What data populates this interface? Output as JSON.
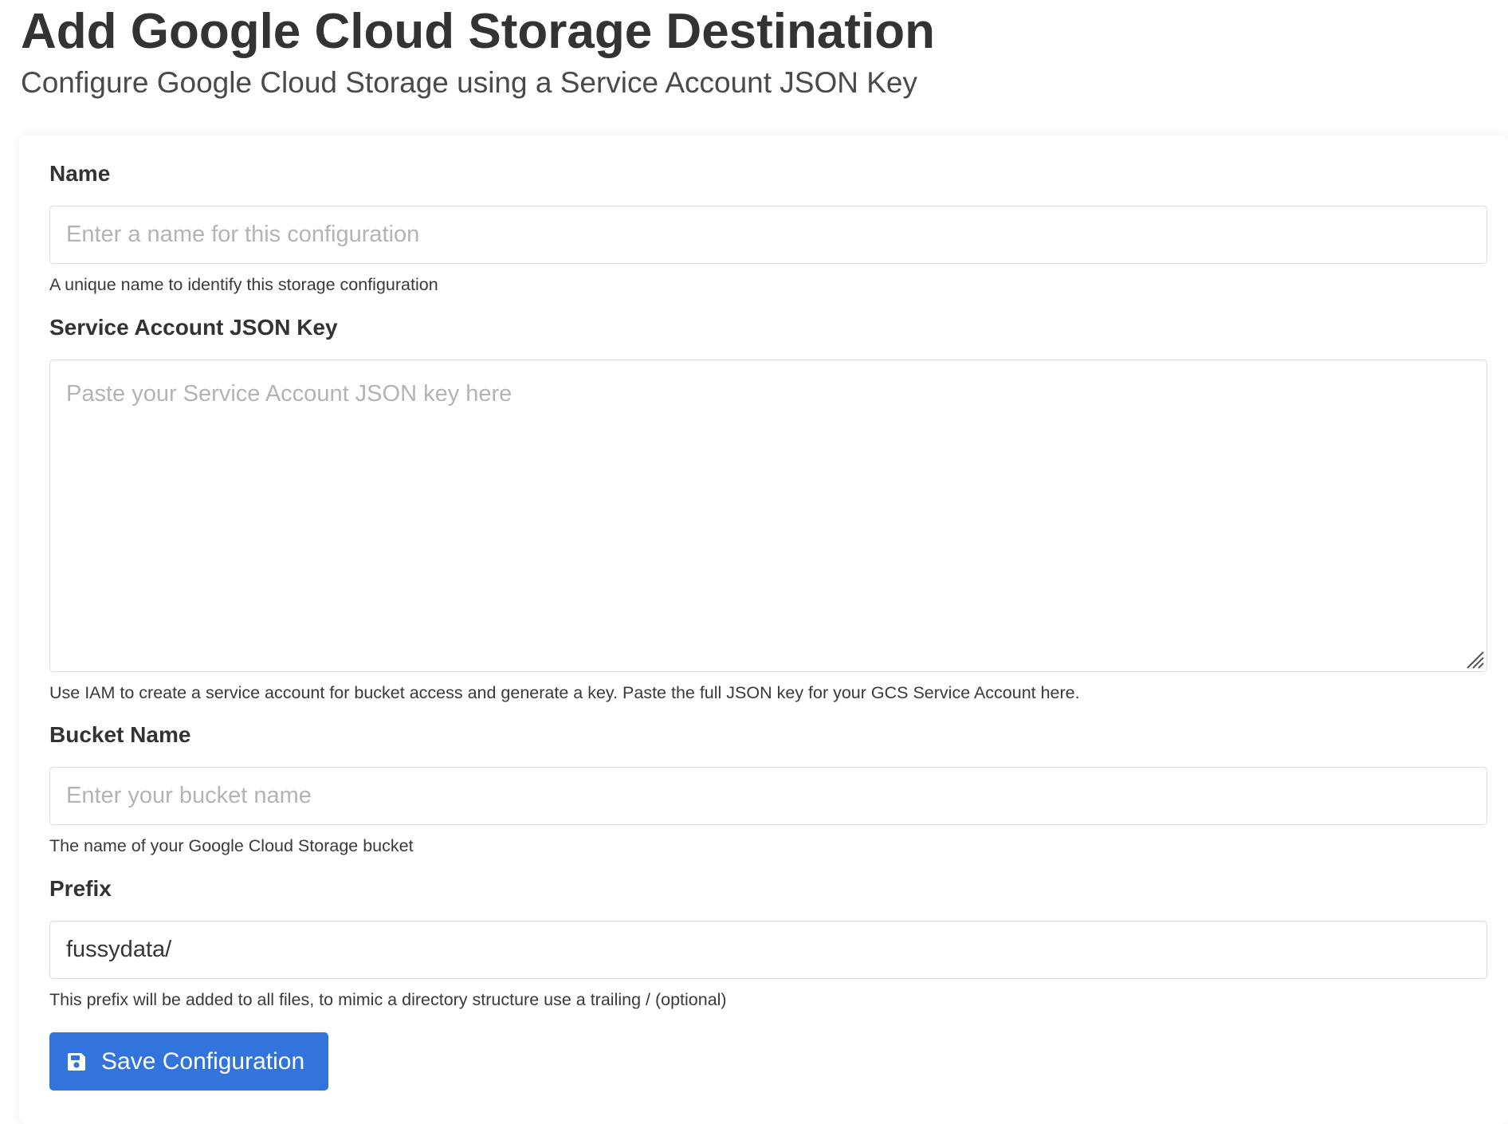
{
  "header": {
    "title": "Add Google Cloud Storage Destination",
    "subtitle": "Configure Google Cloud Storage using a Service Account JSON Key"
  },
  "form": {
    "name": {
      "label": "Name",
      "placeholder": "Enter a name for this configuration",
      "value": "",
      "help": "A unique name to identify this storage configuration"
    },
    "service_account_key": {
      "label": "Service Account JSON Key",
      "placeholder": "Paste your Service Account JSON key here",
      "value": "",
      "help": "Use IAM to create a service account for bucket access and generate a key. Paste the full JSON key for your GCS Service Account here."
    },
    "bucket_name": {
      "label": "Bucket Name",
      "placeholder": "Enter your bucket name",
      "value": "",
      "help": "The name of your Google Cloud Storage bucket"
    },
    "prefix": {
      "label": "Prefix",
      "placeholder": "",
      "value": "fussydata/",
      "help": "This prefix will be added to all files, to mimic a directory structure use a trailing / (optional)"
    },
    "save_button": {
      "label": "Save Configuration",
      "icon": "save-icon"
    }
  },
  "colors": {
    "primary": "#3273dc",
    "text": "#333333",
    "placeholder": "#b4b4b4",
    "border": "#dcdcdc"
  }
}
